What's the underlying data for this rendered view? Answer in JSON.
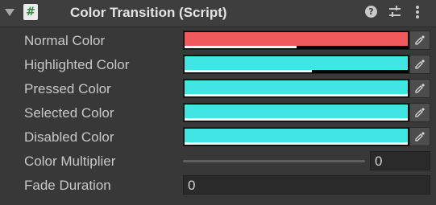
{
  "component": {
    "title": "Color Transition (Script)",
    "script_icon_glyph": "#",
    "help_glyph": "?",
    "header_icons": [
      "foldout-triangle",
      "script-icon",
      "help-icon",
      "presets-icon",
      "kebab-menu-icon"
    ]
  },
  "colors": {
    "normal": "#f05a5c",
    "highlighted": "#40e6e4",
    "pressed": "#40e6e4",
    "selected": "#40e6e4",
    "disabled": "#40e6e4"
  },
  "fields": {
    "normal_color": {
      "label": "Normal Color",
      "color": "#f05a5c",
      "alpha": 0.5
    },
    "highlighted_color": {
      "label": "Highlighted Color",
      "color": "#40e6e4",
      "alpha": 0.57
    },
    "pressed_color": {
      "label": "Pressed Color",
      "color": "#40e6e4",
      "alpha": 1.0
    },
    "selected_color": {
      "label": "Selected Color",
      "color": "#40e6e4",
      "alpha": 1.0
    },
    "disabled_color": {
      "label": "Disabled Color",
      "color": "#40e6e4",
      "alpha": 1.0
    },
    "color_multiplier": {
      "label": "Color Multiplier",
      "value": "0",
      "slider_level": 0
    },
    "fade_duration": {
      "label": "Fade Duration",
      "value": "0"
    }
  },
  "picker_icon": "eyedropper-icon"
}
